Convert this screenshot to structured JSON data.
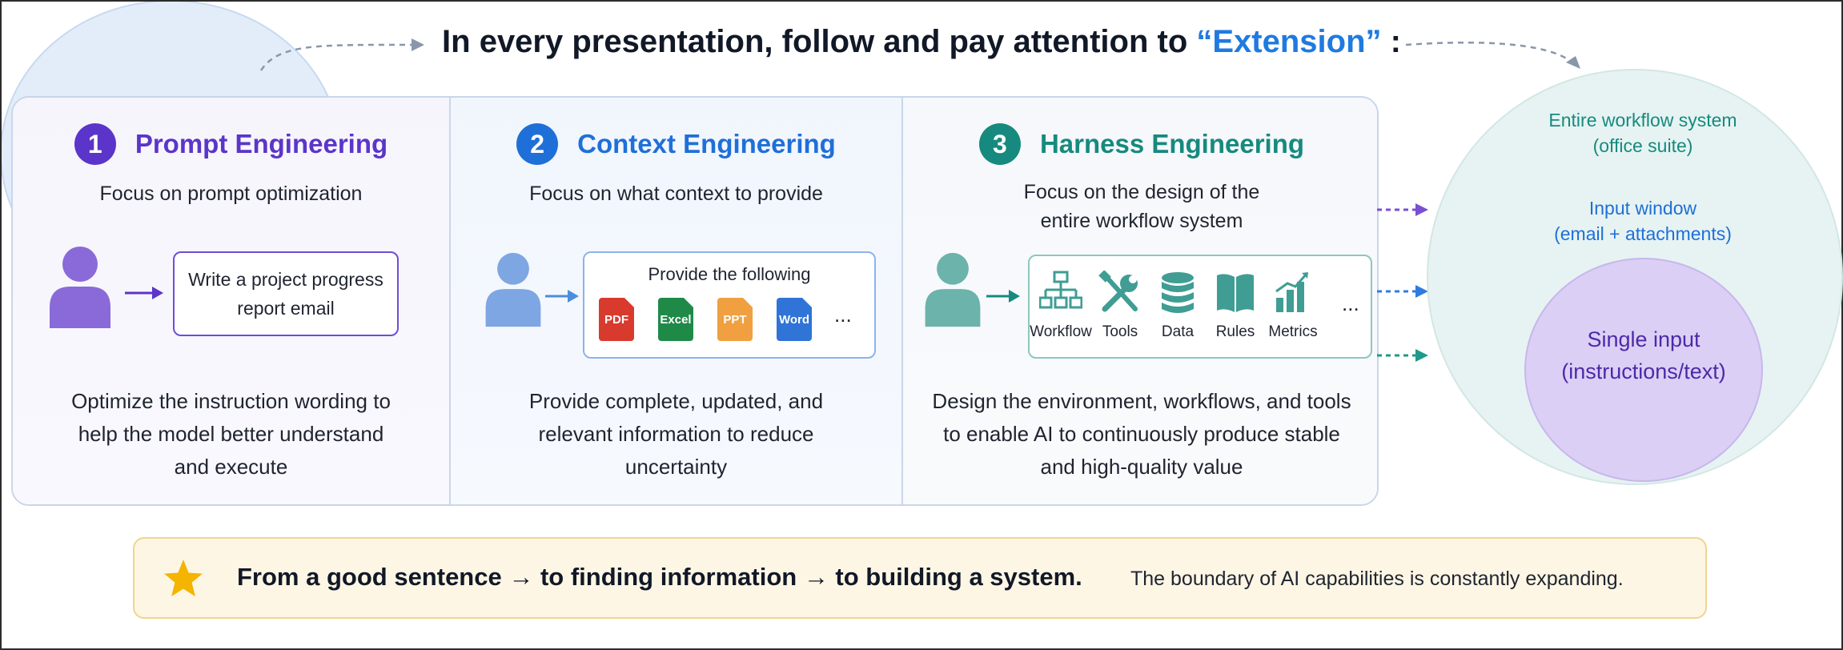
{
  "title": {
    "prefix": "In every presentation, follow and pay attention to ",
    "highlight": "“Extension”",
    "suffix": " :"
  },
  "columns": [
    {
      "number": "1",
      "title": "Prompt Engineering",
      "focus": "Focus on prompt optimization",
      "box_text": "Write a project progress report email",
      "description": "Optimize the instruction wording to help the model better understand and execute"
    },
    {
      "number": "2",
      "title": "Context Engineering",
      "focus": "Focus on what context to provide",
      "box_label": "Provide the following",
      "files": [
        "PDF",
        "Excel",
        "PPT",
        "Word"
      ],
      "more": "...",
      "description": "Provide complete, updated, and relevant information to reduce uncertainty"
    },
    {
      "number": "3",
      "title": "Harness Engineering",
      "focus": "Focus on the design of the entire workflow system",
      "tools": [
        "Workflow",
        "Tools",
        "Data",
        "Rules",
        "Metrics"
      ],
      "more": "...",
      "description": "Design the environment, workflows, and tools to enable AI to continuously produce stable and high-quality value"
    }
  ],
  "circles": {
    "outer": {
      "line1": "Entire workflow system",
      "line2": "(office suite)"
    },
    "middle": {
      "line1": "Input window",
      "line2": "(email + attachments)"
    },
    "inner": {
      "line1": "Single input",
      "line2": "(instructions/text)"
    }
  },
  "banner": {
    "main": "From a good sentence → to finding information → to building a system.",
    "side": "The boundary of AI capabilities is constantly expanding."
  },
  "colors": {
    "purple": "#5b35c9",
    "blue": "#1f6fd8",
    "teal": "#168a7e",
    "highlight": "#1f7ae0"
  }
}
